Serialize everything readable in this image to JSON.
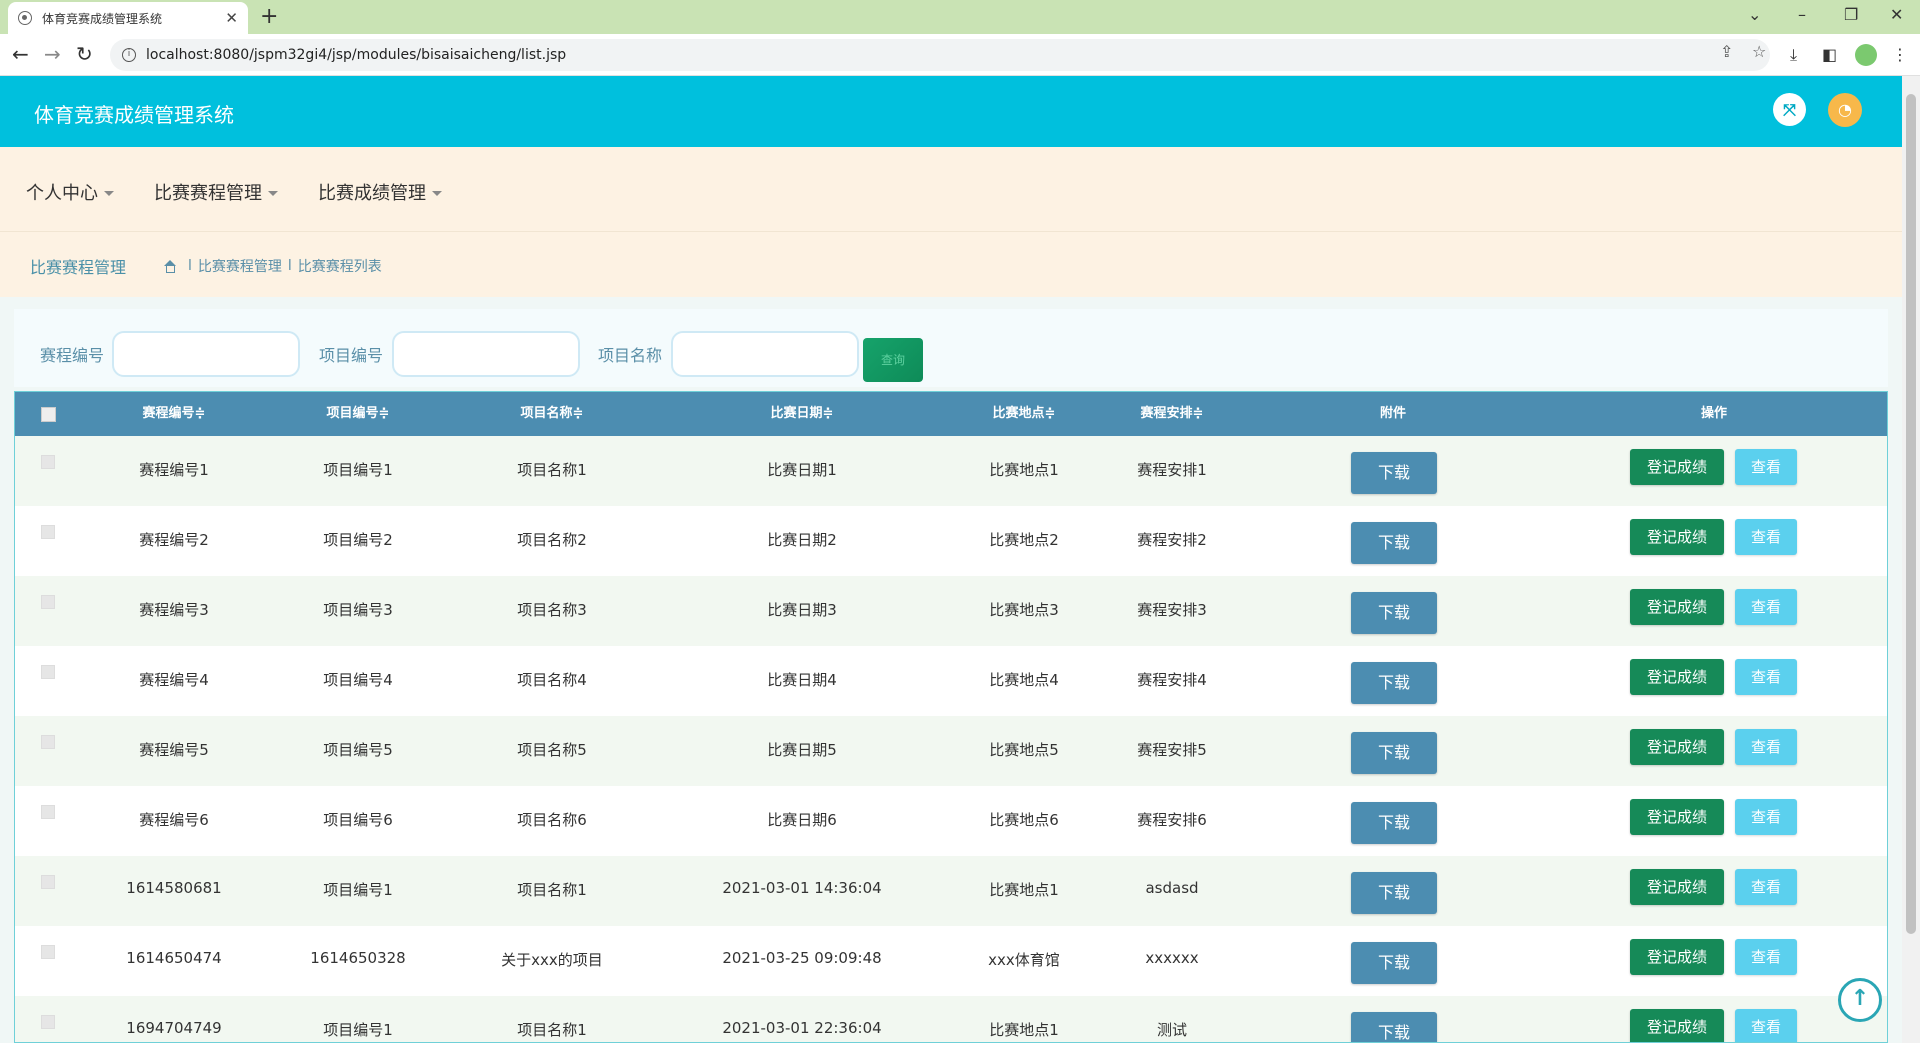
{
  "browser": {
    "tab_title": "体育竞赛成绩管理系统",
    "url": "localhost:8080/jspm32gi4/jsp/modules/bisaisaicheng/list.jsp"
  },
  "app": {
    "title": "体育竞赛成绩管理系统"
  },
  "nav": {
    "items": [
      {
        "label": "个人中心"
      },
      {
        "label": "比赛赛程管理"
      },
      {
        "label": "比赛成绩管理"
      }
    ]
  },
  "breadcrumb": {
    "title": "比赛赛程管理",
    "sep1": "l",
    "path1": "比赛赛程管理",
    "sep2": "l",
    "path2": "比赛赛程列表"
  },
  "search": {
    "label1": "赛程编号",
    "label2": "项目编号",
    "label3": "项目名称",
    "button": "查询"
  },
  "table": {
    "headers": [
      "赛程编号",
      "项目编号",
      "项目名称",
      "比赛日期",
      "比赛地点",
      "赛程安排",
      "附件",
      "操作"
    ],
    "download_label": "下载",
    "register_label": "登记成绩",
    "view_label": "查看",
    "rows": [
      {
        "c1": "赛程编号1",
        "c2": "项目编号1",
        "c3": "项目名称1",
        "c4": "比赛日期1",
        "c5": "比赛地点1",
        "c6": "赛程安排1"
      },
      {
        "c1": "赛程编号2",
        "c2": "项目编号2",
        "c3": "项目名称2",
        "c4": "比赛日期2",
        "c5": "比赛地点2",
        "c6": "赛程安排2"
      },
      {
        "c1": "赛程编号3",
        "c2": "项目编号3",
        "c3": "项目名称3",
        "c4": "比赛日期3",
        "c5": "比赛地点3",
        "c6": "赛程安排3"
      },
      {
        "c1": "赛程编号4",
        "c2": "项目编号4",
        "c3": "项目名称4",
        "c4": "比赛日期4",
        "c5": "比赛地点4",
        "c6": "赛程安排4"
      },
      {
        "c1": "赛程编号5",
        "c2": "项目编号5",
        "c3": "项目名称5",
        "c4": "比赛日期5",
        "c5": "比赛地点5",
        "c6": "赛程安排5"
      },
      {
        "c1": "赛程编号6",
        "c2": "项目编号6",
        "c3": "项目名称6",
        "c4": "比赛日期6",
        "c5": "比赛地点6",
        "c6": "赛程安排6"
      },
      {
        "c1": "1614580681",
        "c2": "项目编号1",
        "c3": "项目名称1",
        "c4": "2021-03-01 14:36:04",
        "c5": "比赛地点1",
        "c6": "asdasd"
      },
      {
        "c1": "1614650474",
        "c2": "1614650328",
        "c3": "关于xxx的项目",
        "c4": "2021-03-25 09:09:48",
        "c5": "xxx体育馆",
        "c6": "xxxxxx"
      },
      {
        "c1": "1694704749",
        "c2": "项目编号1",
        "c3": "项目名称1",
        "c4": "2021-03-01 22:36:04",
        "c5": "比赛地点1",
        "c6": "测试"
      }
    ]
  },
  "colors": {
    "header": "#00c0dd",
    "nav_bg": "#fdf2e3",
    "table_header": "#4c8db1",
    "register_btn": "#168a58",
    "view_btn": "#5bd0ee"
  }
}
